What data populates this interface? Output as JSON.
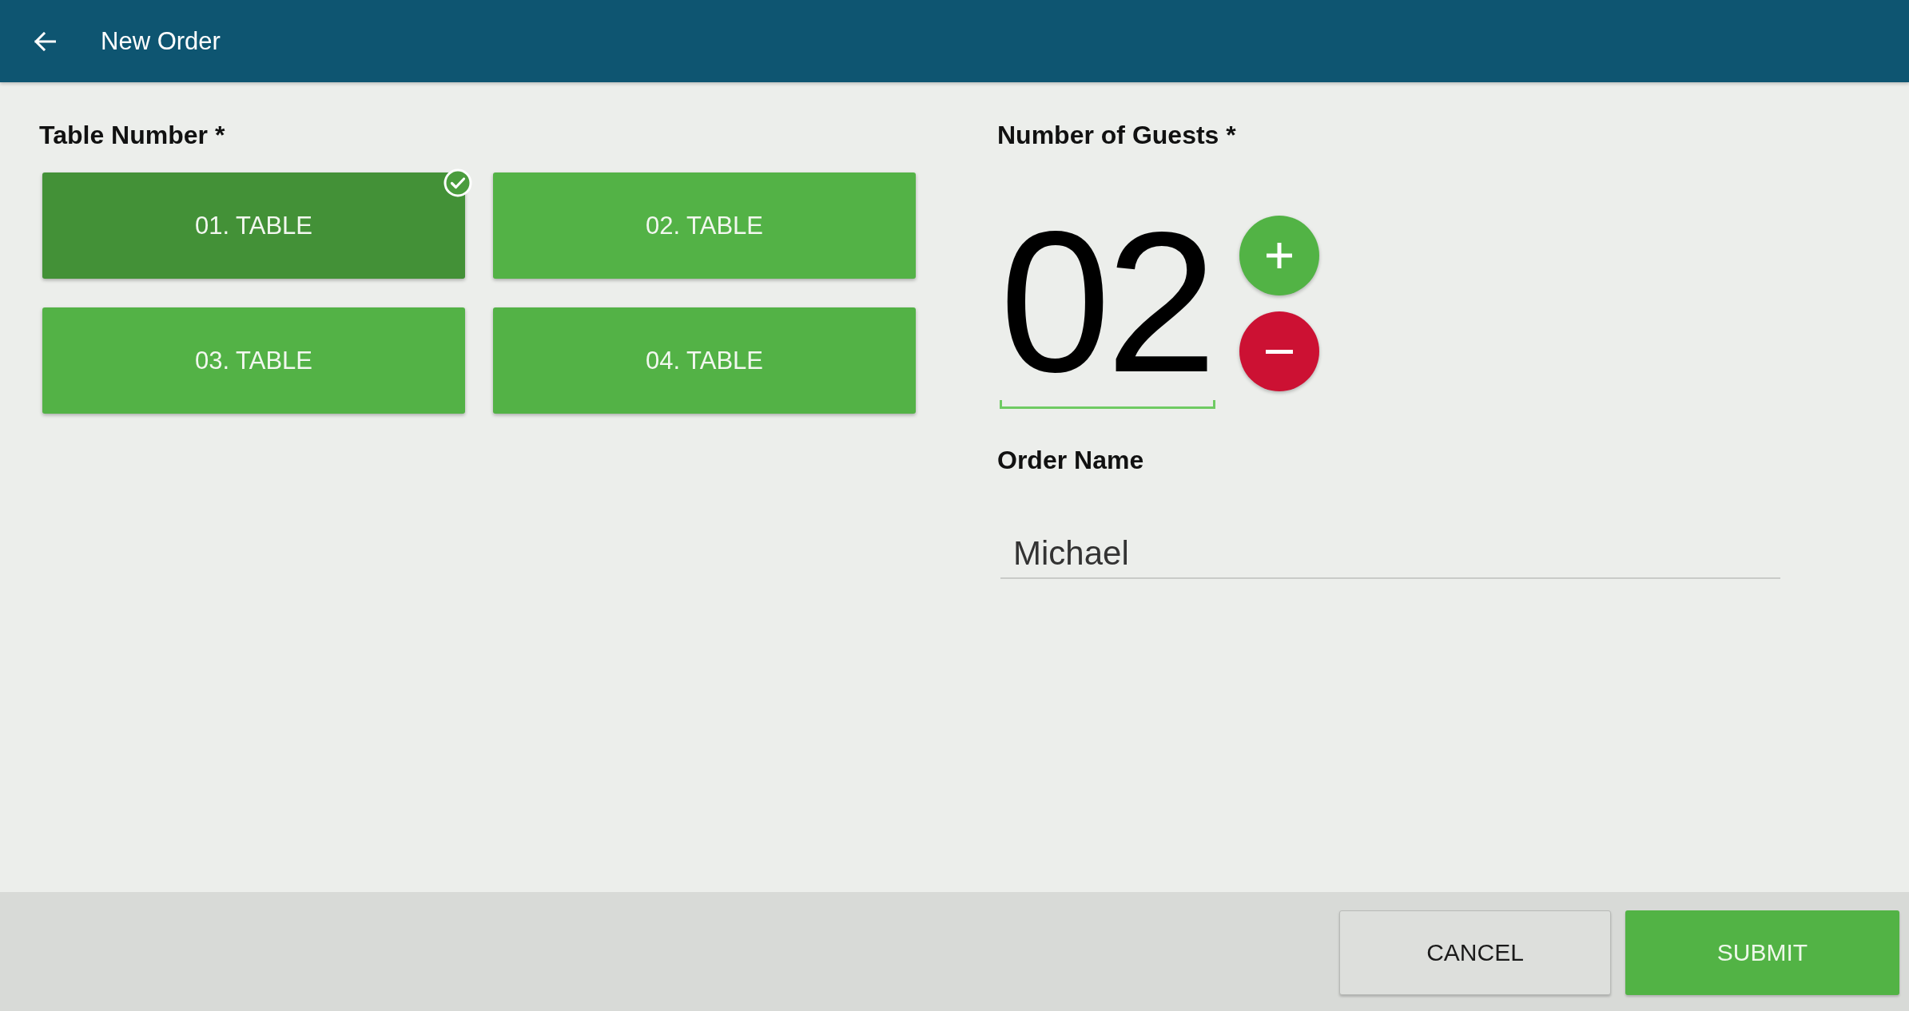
{
  "header": {
    "title": "New Order"
  },
  "table_number": {
    "label": "Table Number *",
    "tables": [
      {
        "label": "01. TABLE",
        "selected": true
      },
      {
        "label": "02. TABLE",
        "selected": false
      },
      {
        "label": "03. TABLE",
        "selected": false
      },
      {
        "label": "04. TABLE",
        "selected": false
      }
    ]
  },
  "guests": {
    "label": "Number of Guests *",
    "value": "02"
  },
  "order_name": {
    "label": "Order Name",
    "value": "Michael"
  },
  "buttons": [
    {
      "label": "CANCEL",
      "kind": "secondary"
    },
    {
      "label": "SUBMIT",
      "kind": "primary"
    }
  ]
}
